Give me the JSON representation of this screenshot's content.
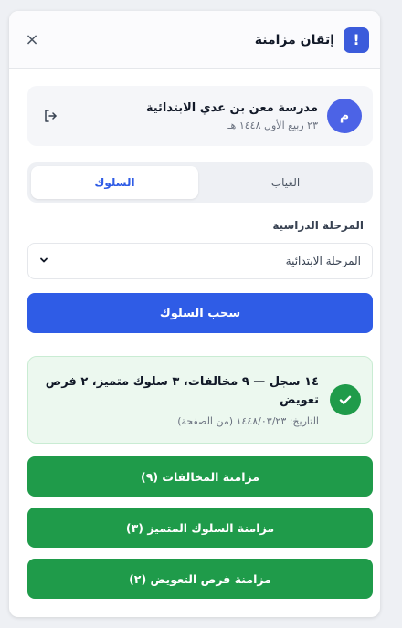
{
  "header": {
    "logo_text": "!",
    "title": "إتقان مزامنة",
    "close_icon": "×"
  },
  "school": {
    "avatar_letter": "م",
    "name": "مدرسة معن بن عدي الابتدائية",
    "date": "٢٣ ربيع الأول ١٤٤٨ هـ"
  },
  "tabs": [
    {
      "label": "الغياب",
      "active": false
    },
    {
      "label": "السلوك",
      "active": true
    }
  ],
  "stage": {
    "label": "المرحلة الدراسية",
    "value": "المرحلة الابتدائية"
  },
  "actions": {
    "pull_label": "سحب السلوك"
  },
  "result": {
    "summary": "١٤ سجل — ٩ مخالفات، ٣ سلوك متميز، ٢ فرص تعويض",
    "date_line": "التاريخ: ١٤٤٨/٠٣/٢٣ (من الصفحة)"
  },
  "sync_buttons": [
    {
      "label": "مزامنة المخالفات (٩)"
    },
    {
      "label": "مزامنة السلوك المتميز (٣)"
    },
    {
      "label": "مزامنة فرص التعويض (٢)"
    }
  ],
  "colors": {
    "primary": "#2f5ce6",
    "success": "#1f9b4a",
    "success_bg": "#ecf8ef"
  }
}
